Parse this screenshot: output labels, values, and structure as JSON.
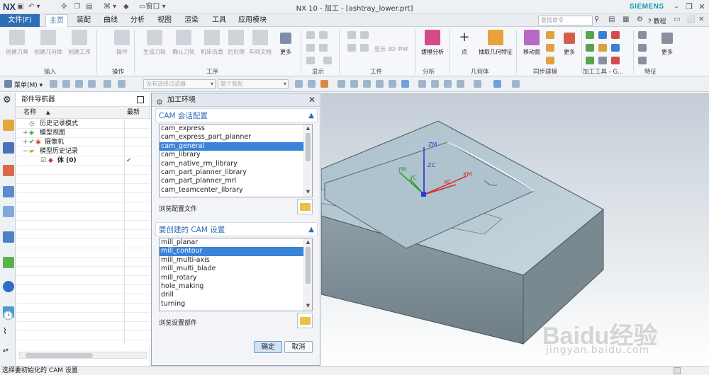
{
  "titlebar": {
    "logo": "NX",
    "title": "NX 10 - 加工 - [ashtray_lower.prt]",
    "brand": "SIEMENS",
    "window_menu": "窗口"
  },
  "menubar": {
    "file": "文件(F)",
    "tabs": [
      "主页",
      "装配",
      "曲线",
      "分析",
      "视图",
      "渲染",
      "工具",
      "应用模块"
    ],
    "active_tab": "主页",
    "search_placeholder": "查找命令",
    "help": "教程"
  },
  "ribbon": {
    "buttons": [
      "创建刀具",
      "创建几何体",
      "创建工序",
      "操作",
      "生成刀轨",
      "确认刀轨",
      "机床仿真",
      "后处理",
      "车间文档",
      "更多",
      "显示 3D IPW",
      "拔模分析",
      "点",
      "抽取几何特征",
      "移动面",
      "更多",
      "更多"
    ],
    "groups": [
      "插入",
      "操作",
      "工序",
      "显示",
      "工件",
      "分析",
      "几何体",
      "同步建模",
      "加工工具 - G...",
      "特征"
    ]
  },
  "toolbar2": {
    "menu": "菜单(M)",
    "filter": "没有选择过滤器",
    "scope": "整个装配"
  },
  "navigator": {
    "title": "部件导航器",
    "col_name": "名称",
    "col_latest": "最新",
    "rows": [
      {
        "label": "历史记录模式",
        "indent": 1
      },
      {
        "label": "模型视图",
        "indent": 1
      },
      {
        "label": "摄像机",
        "indent": 1
      },
      {
        "label": "模型历史记录",
        "indent": 1
      },
      {
        "label": "体 (0)",
        "indent": 2
      }
    ]
  },
  "dialog": {
    "title": "加工环境",
    "section1": "CAM 会话配置",
    "list1": [
      "cam_express",
      "cam_express_part_planner",
      "cam_general",
      "cam_library",
      "cam_native_rm_library",
      "cam_part_planner_library",
      "cam_part_planner_mrl",
      "cam_teamcenter_library"
    ],
    "list1_selected": "cam_general",
    "browse1": "浏览配置文件",
    "section2": "要创建的 CAM 设置",
    "list2": [
      "mill_planar",
      "mill_contour",
      "mill_multi-axis",
      "mill_multi_blade",
      "mill_rotary",
      "hole_making",
      "drill",
      "turning"
    ],
    "list2_selected": "mill_contour",
    "browse2": "浏览设置部件",
    "ok": "确定",
    "cancel": "取消"
  },
  "viewport": {
    "axes": {
      "zm": "ZM",
      "zc": "ZC",
      "ym": "YM",
      "yc": "YC",
      "xm": "XM",
      "xc": "XC"
    },
    "watermark": "Baidu经验",
    "watermark_url": "jingyan.baidu.com"
  },
  "statusbar": {
    "text": "选择要初始化的 CAM 设置"
  }
}
